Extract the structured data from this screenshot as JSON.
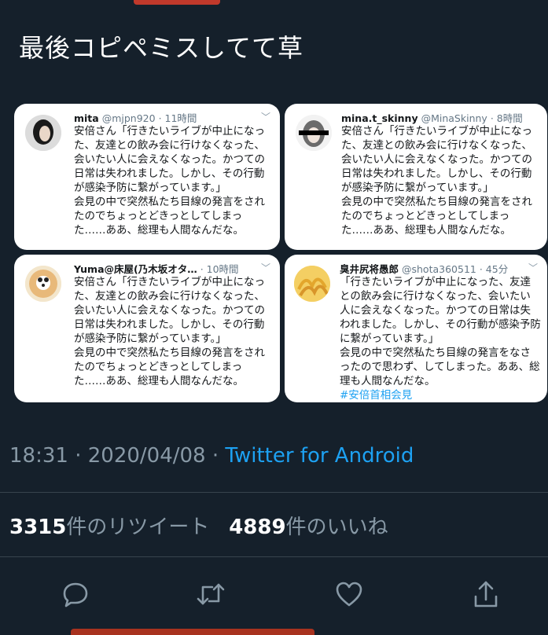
{
  "tweet": {
    "text": "最後コピペミスしてて草"
  },
  "cards": [
    {
      "name": "mita",
      "handle": "@mjpn920",
      "time": "· 11時間",
      "text": "安倍さん「行きたいライブが中止になった、友達との飲み会に行けなくなった、会いたい人に会えなくなった。かつての日常は失われました。しかし、その行動が感染予防に繋がっています。」\n会見の中で突然私たち目線の発言をされたのでちょっとどきっとしてしまった……ああ、総理も人間なんだな。"
    },
    {
      "name": "mina.t_skinny",
      "handle": "@MinaSkinny",
      "time": "· 8時間",
      "text": "安倍さん「行きたいライブが中止になった、友達との飲み会に行けなくなった、会いたい人に会えなくなった。かつての日常は失われました。しかし、その行動が感染予防に繋がっています。」\n会見の中で突然私たち目線の発言をされたのでちょっとどきっとしてしまった……ああ、総理も人間なんだな。"
    },
    {
      "name": "Yuma@床屋(乃木坂オタ…",
      "handle": "",
      "time": "· 10時間",
      "text": "安倍さん「行きたいライブが中止になった、友達との飲み会に行けなくなった、会いたい人に会えなくなった。かつての日常は失われました。しかし、その行動が感染予防に繋がっています。」\n会見の中で突然私たち目線の発言をされたのでちょっとどきっとしてしまった……ああ、総理も人間なんだな。"
    },
    {
      "name": "臭井尻将愚郎",
      "handle": "@shota360511",
      "time": "· 45分",
      "text": "「行きたいライブが中止になった、友達との飲み会に行けなくなった、会いたい人に会えなくなった。かつての日常は失われました。しかし、その行動が感染予防に繋がっています。」\n会見の中で突然私たち目線の発言をなさったので思わず、してしまった。ああ、総理も人間なんだな。",
      "hashtag": "#安倍首相会見"
    }
  ],
  "meta": {
    "time": "18:31",
    "sep1": "·",
    "date": "2020/04/08",
    "sep2": "·",
    "client": "Twitter for Android"
  },
  "stats": {
    "retweets": "3315",
    "retweets_label": "件のリツイート",
    "likes": "4889",
    "likes_label": "件のいいね"
  },
  "icons": [
    "reply-icon",
    "retweet-icon",
    "like-icon",
    "share-icon"
  ],
  "colors": {
    "background": "#15202b",
    "accent": "#1da1f2",
    "muted": "#8899a6"
  }
}
